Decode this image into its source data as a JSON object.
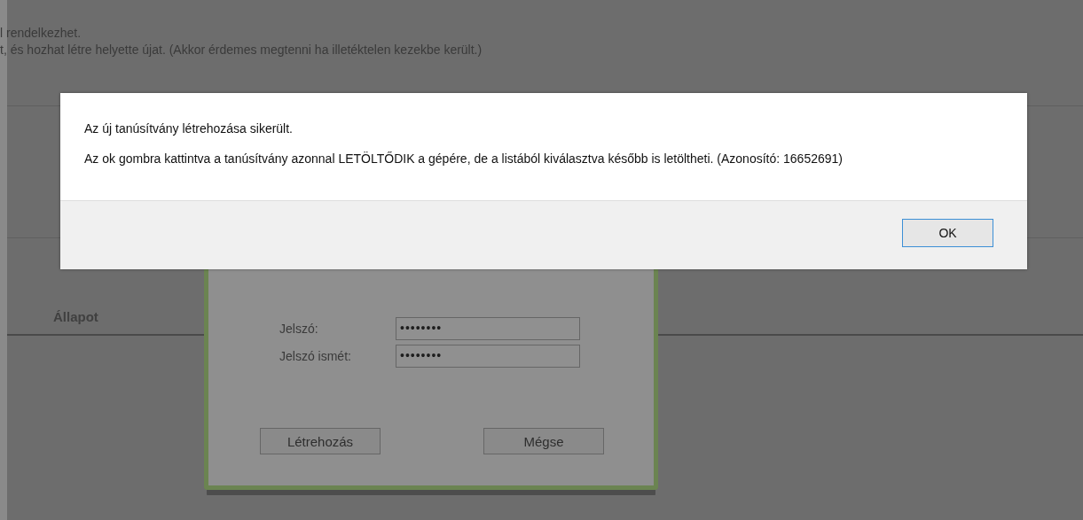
{
  "background_page": {
    "text_lines": [
      "l rendelkezhet.",
      "t, és hozhat létre helyette újat. (Akkor érdemes megtenni ha illetéktelen kezekbe került.)"
    ],
    "column_header": "Állapot"
  },
  "create_dialog": {
    "fields": [
      {
        "label": "Jelszó:",
        "value": "••••••••"
      },
      {
        "label": "Jelszó ismét:",
        "value": "••••••••"
      }
    ],
    "buttons": [
      "Létrehozás",
      "Mégse"
    ]
  },
  "message_dialog": {
    "lines": [
      "Az új tanúsítvány létrehozása sikerült.",
      "Az ok gombra kattintva a tanúsítvány azonnal LETÖLTŐDIK a gépére, de a listából kiválasztva később is letöltheti. (Azonosító: 16652691)"
    ],
    "button": "OK"
  }
}
